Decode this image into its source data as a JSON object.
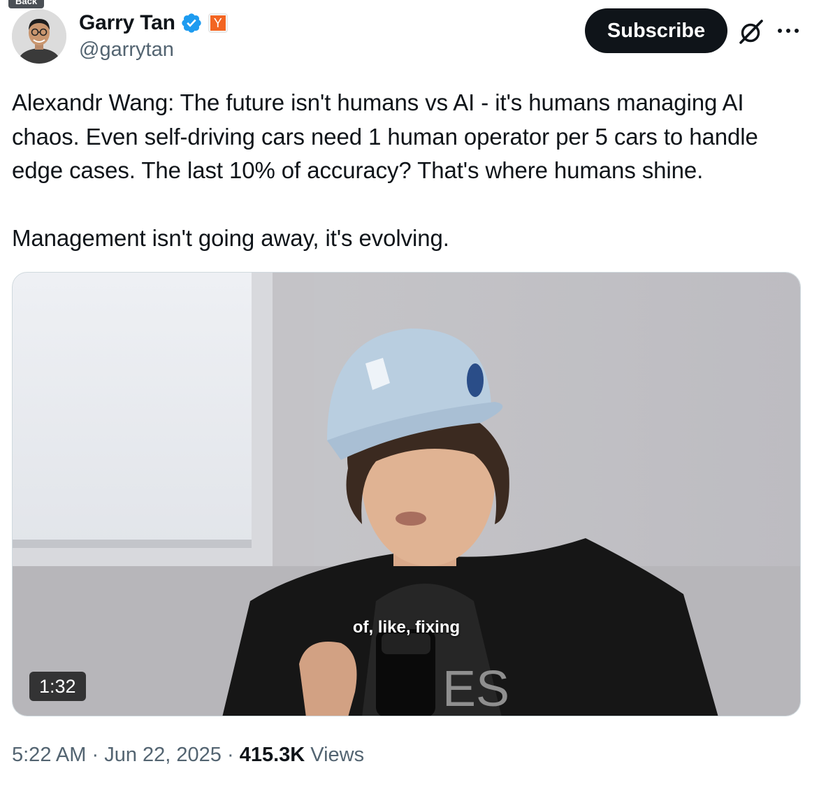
{
  "nav": {
    "back_label": "Back"
  },
  "author": {
    "display_name": "Garry Tan",
    "handle": "@garrytan",
    "badge_letter": "Y",
    "verified_color": "#1d9bf0",
    "badge_color": "#f26522"
  },
  "actions": {
    "subscribe_label": "Subscribe",
    "grok_icon": "grok-icon",
    "more_icon": "more-options-icon"
  },
  "tweet": {
    "paragraph_1": "Alexandr Wang: The future isn't humans vs AI - it's humans managing AI chaos. Even self-driving cars need 1 human operator per 5 cars to handle edge cases. The last 10% of accuracy? That's where humans shine.",
    "paragraph_2": "Management isn't going away, it's evolving."
  },
  "media": {
    "type": "video",
    "caption": "of, like, fixing",
    "duration": "1:32"
  },
  "meta": {
    "time": "5:22 AM",
    "separator": "·",
    "date": "Jun 22, 2025",
    "views_count": "415.3K",
    "views_label": "Views"
  }
}
